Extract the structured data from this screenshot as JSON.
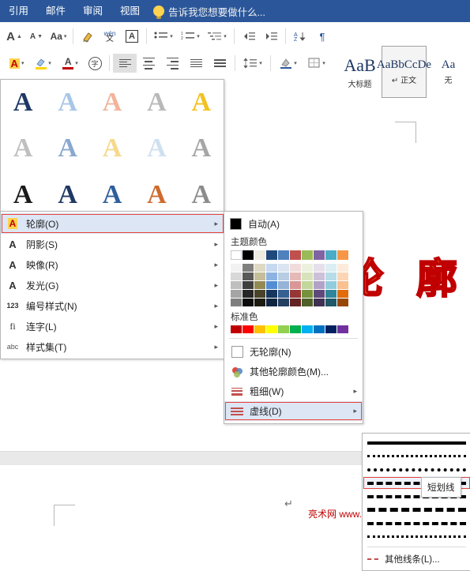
{
  "ribbon": {
    "tabs": [
      {
        "label": "引用"
      },
      {
        "label": "邮件"
      },
      {
        "label": "审阅"
      },
      {
        "label": "视图"
      }
    ],
    "tell_me": "告诉我您想要做什么...",
    "tell_me_icon": "lightbulb-icon",
    "row1": [
      {
        "name": "font-grow-button",
        "glyph": "A",
        "sub": "▲"
      },
      {
        "name": "font-shrink-button",
        "glyph": "A",
        "sub": "▼"
      },
      {
        "name": "change-case-button",
        "glyph": "Aa"
      },
      {
        "name": "clear-formatting-button",
        "glyph": "✎"
      },
      {
        "name": "phonetic-guide-button",
        "glyph": "wén"
      },
      {
        "name": "character-border-button",
        "glyph": "A"
      },
      {
        "name": "bullets-button",
        "glyph": "≔"
      },
      {
        "name": "numbering-button",
        "glyph": "⒈"
      },
      {
        "name": "multilevel-list-button",
        "glyph": "⋮≡"
      },
      {
        "name": "decrease-indent-button",
        "glyph": "◄≡"
      },
      {
        "name": "increase-indent-button",
        "glyph": "≡►"
      },
      {
        "name": "sort-button",
        "glyph": "A↓"
      },
      {
        "name": "show-marks-button",
        "glyph": "¶"
      }
    ],
    "row2": [
      {
        "name": "text-effects-button",
        "glyph": "A"
      },
      {
        "name": "text-highlight-button",
        "glyph": "✏"
      },
      {
        "name": "font-color-button",
        "glyph": "A"
      },
      {
        "name": "enclose-characters-button",
        "glyph": "字"
      },
      {
        "name": "align-left-button",
        "glyph": "≡"
      },
      {
        "name": "align-center-button",
        "glyph": "≡"
      },
      {
        "name": "align-right-button",
        "glyph": "≡"
      },
      {
        "name": "justify-button",
        "glyph": "≡"
      },
      {
        "name": "distribute-button",
        "glyph": "≣"
      },
      {
        "name": "line-spacing-button",
        "glyph": "↕≡"
      },
      {
        "name": "shading-button",
        "glyph": "▲"
      },
      {
        "name": "borders-button",
        "glyph": "⊞"
      }
    ],
    "styles": [
      {
        "name": "style-heading1",
        "sample": "AaB",
        "caption": "大标题",
        "selected": false
      },
      {
        "name": "style-normal",
        "sample": "AaBbCcDe",
        "caption": "↵ 正文",
        "selected": true
      },
      {
        "name": "style-nospacing",
        "sample": "Aa",
        "caption": "无",
        "selected": false
      }
    ]
  },
  "document": {
    "wordart_text": "字 的 轮 廓",
    "paragraph_mark": "↵",
    "watermark_line": "亮术网  www.liangshunet.com"
  },
  "wordart_gallery": {
    "name": "wordart-gallery",
    "cells": [
      {
        "glyph": "A",
        "fill": "#1f3864",
        "stroke": ""
      },
      {
        "glyph": "A",
        "fill": "#a8c6e8",
        "stroke": ""
      },
      {
        "glyph": "A",
        "fill": "#f2b49a",
        "stroke": ""
      },
      {
        "glyph": "A",
        "fill": "#b9b9b9",
        "stroke": ""
      },
      {
        "glyph": "A",
        "fill": "#f2c222",
        "stroke": ""
      },
      {
        "glyph": "A",
        "fill": "#bfbfbf",
        "stroke": ""
      },
      {
        "glyph": "A",
        "fill": "#8aa9d0",
        "stroke": ""
      },
      {
        "glyph": "A",
        "fill": "#f5d98c",
        "stroke": ""
      },
      {
        "glyph": "A",
        "fill": "#cfe0f0",
        "stroke": ""
      },
      {
        "glyph": "A",
        "fill": "#a6a6a6",
        "stroke": ""
      },
      {
        "glyph": "A",
        "fill": "#1a1a1a",
        "stroke": ""
      },
      {
        "glyph": "A",
        "fill": "#1f3864",
        "stroke": ""
      },
      {
        "glyph": "A",
        "fill": "#2e5f9e",
        "stroke": ""
      },
      {
        "glyph": "A",
        "fill": "#d06a2c",
        "stroke": ""
      },
      {
        "glyph": "A",
        "fill": "#8c8c8c",
        "stroke": ""
      }
    ]
  },
  "effects_menu": {
    "name": "text-effects-menu",
    "items": [
      {
        "label": "轮廓(O)",
        "icon": "outline-A-icon",
        "arrow": "▸",
        "highlight": true
      },
      {
        "label": "阴影(S)",
        "icon": "shadow-A-icon",
        "arrow": "▸",
        "highlight": false
      },
      {
        "label": "映像(R)",
        "icon": "reflection-A-icon",
        "arrow": "▸",
        "highlight": false
      },
      {
        "label": "发光(G)",
        "icon": "glow-A-icon",
        "arrow": "▸",
        "highlight": false
      },
      {
        "label": "编号样式(N)",
        "icon": "number-style-icon",
        "arrow": "▸",
        "highlight": false
      },
      {
        "label": "连字(L)",
        "icon": "ligature-icon",
        "arrow": "▸",
        "highlight": false
      },
      {
        "label": "样式集(T)",
        "icon": "stylistic-sets-icon",
        "arrow": "▸",
        "highlight": false
      }
    ]
  },
  "color_menu": {
    "name": "outline-color-menu",
    "automatic": {
      "label": "自动(A)",
      "swatch": "#000000"
    },
    "theme_header": "主题颜色",
    "theme_colors_row1": [
      "#ffffff",
      "#000000",
      "#eeece1",
      "#1f497d",
      "#4f81bd",
      "#c0504d",
      "#9bbb59",
      "#8064a2",
      "#4bacc6",
      "#f79646"
    ],
    "theme_shades": [
      [
        "#f2f2f2",
        "#7f7f7f",
        "#ddd9c3",
        "#c6d9f0",
        "#dbe5f1",
        "#f2dcdb",
        "#ebf1dd",
        "#e5e0ec",
        "#dbeef3",
        "#fdeada"
      ],
      [
        "#d8d8d8",
        "#595959",
        "#c4bd97",
        "#8db3e2",
        "#b8cce4",
        "#e5b9b7",
        "#d7e3bc",
        "#ccc1d9",
        "#b7dde8",
        "#fbd5b5"
      ],
      [
        "#bfbfbf",
        "#3f3f3f",
        "#938953",
        "#548dd4",
        "#95b3d7",
        "#d99694",
        "#c3d69b",
        "#b2a2c7",
        "#92cddc",
        "#fac08f"
      ],
      [
        "#a5a5a5",
        "#262626",
        "#494429",
        "#17365d",
        "#366092",
        "#953734",
        "#76923c",
        "#5f497a",
        "#31859b",
        "#e36c09"
      ],
      [
        "#7f7f7f",
        "#0c0c0c",
        "#1d1b10",
        "#0f243e",
        "#244061",
        "#632423",
        "#4f6128",
        "#3f3151",
        "#205867",
        "#974806"
      ]
    ],
    "standard_header": "标准色",
    "standard_colors": [
      "#c00000",
      "#ff0000",
      "#ffc000",
      "#ffff00",
      "#92d050",
      "#00b050",
      "#00b0f0",
      "#0070c0",
      "#002060",
      "#7030a0"
    ],
    "no_outline": {
      "label": "无轮廓(N)",
      "icon": "no-outline-icon"
    },
    "more_colors": {
      "label": "其他轮廓颜色(M)...",
      "icon": "more-colors-icon"
    },
    "weight": {
      "label": "粗细(W)",
      "icon": "weight-icon",
      "arrow": "▸"
    },
    "dash": {
      "label": "虚线(D)",
      "icon": "dash-icon",
      "arrow": "▸",
      "highlight": true
    }
  },
  "dash_menu": {
    "name": "dash-style-menu",
    "options": [
      {
        "name": "dash-solid",
        "style": "solid",
        "thickness": 4,
        "selected": false
      },
      {
        "name": "dash-round-dot",
        "style": "dotted",
        "thickness": 3,
        "selected": false
      },
      {
        "name": "dash-square-dot",
        "style": "dotted",
        "thickness": 4,
        "selected": false
      },
      {
        "name": "dash-dash",
        "style": "dashed",
        "thickness": 4,
        "selected": true
      },
      {
        "name": "dash-dash-dot",
        "style": "dashed",
        "thickness": 4,
        "selected": false
      },
      {
        "name": "dash-long-dash",
        "style": "dashed",
        "thickness": 5,
        "selected": false
      },
      {
        "name": "dash-long-dash-dot",
        "style": "dashed",
        "thickness": 4,
        "selected": false
      },
      {
        "name": "dash-long-dash-dot-dot",
        "style": "dotted",
        "thickness": 3,
        "selected": false
      }
    ],
    "more": {
      "label": "其他线条(L)...",
      "icon": "more-lines-icon"
    },
    "tooltip": "短划线"
  }
}
